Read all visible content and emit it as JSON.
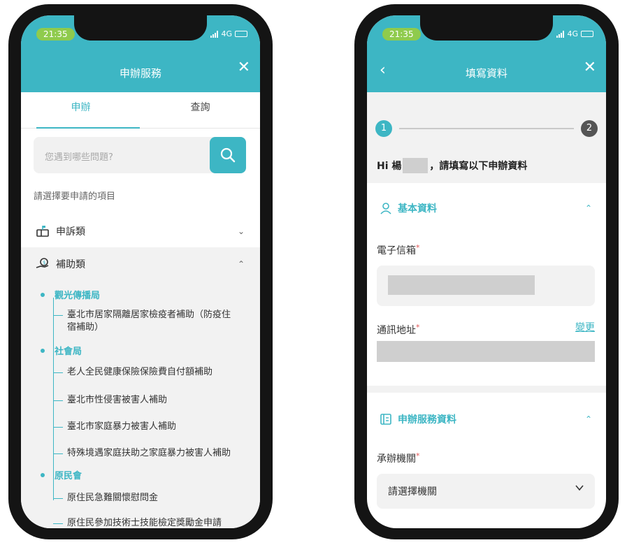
{
  "left": {
    "status": {
      "time": "21:35",
      "network": "4G"
    },
    "header": {
      "title": "申辦服務",
      "close": "✕"
    },
    "tabs": [
      {
        "label": "申辦"
      },
      {
        "label": "查詢"
      }
    ],
    "search": {
      "placeholder": "您遇到哪些問題?"
    },
    "prompt": "請選擇要申請的項目",
    "categories": [
      {
        "label": "申訴類",
        "icon": "mailbox-icon",
        "chevron": "⌄"
      },
      {
        "label": "補助類",
        "icon": "hand-coin-icon",
        "chevron": "⌃"
      }
    ],
    "departments": [
      {
        "name": "觀光傳播局",
        "items": [
          "臺北市居家隔離居家檢疫者補助（防疫住",
          "宿補助）"
        ]
      },
      {
        "name": "社會局",
        "items": [
          "老人全民健康保險保險費自付額補助",
          "臺北市性侵害被害人補助",
          "臺北市家庭暴力被害人補助",
          "特殊境遇家庭扶助之家庭暴力被害人補助"
        ]
      },
      {
        "name": "原民會",
        "items": [
          "原住民急難關懷慰問金",
          "原住民參加技術士技能檢定獎勵金申請"
        ]
      }
    ]
  },
  "right": {
    "status": {
      "time": "21:35",
      "network": "4G"
    },
    "header": {
      "title": "填寫資料",
      "close": "✕",
      "back": "‹"
    },
    "steps": [
      "1",
      "2"
    ],
    "greeting": {
      "prefix": "Hi 楊",
      "suffix": "，請填寫以下申辦資料"
    },
    "section_basic": {
      "title": "基本資料",
      "chevron": "⌃"
    },
    "email_label": "電子信箱",
    "address_label": "通訊地址",
    "change_link": "變更",
    "required_mark": "*",
    "section_service": {
      "title": "申辦服務資料",
      "chevron": "⌃"
    },
    "agency_label": "承辦機關",
    "agency_select": "請選擇機關"
  },
  "colors": {
    "primary": "#3db6c4",
    "time_pill": "#8fcb4d",
    "required": "#e05555"
  }
}
